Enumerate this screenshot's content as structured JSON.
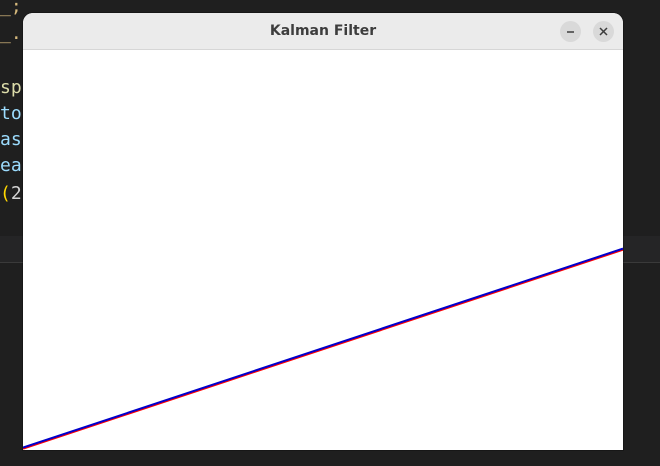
{
  "background_editor": {
    "code_fragments": [
      {
        "text": "_;",
        "color": "#d7ba7d"
      },
      {
        "text": "_.",
        "color": "#d7ba7d"
      },
      {
        "text": "sp",
        "color": "#dcdcaa"
      },
      {
        "text": "to",
        "color": "#9cdcfe"
      },
      {
        "text": "as",
        "color": "#9cdcfe"
      },
      {
        "text": "ea",
        "color": "#9cdcfe"
      },
      {
        "text": "(2",
        "color": "#d4d4d4",
        "paren_color": "#ffd700"
      }
    ]
  },
  "window": {
    "title": "Kalman Filter",
    "minimize_icon": "minimize-icon",
    "close_icon": "close-icon"
  },
  "plot": {
    "series": [
      {
        "color": "#ff0000",
        "start": [
          0,
          0
        ],
        "end": [
          1,
          0.5
        ]
      },
      {
        "color": "#0000cc",
        "start": [
          0,
          0
        ],
        "end": [
          1,
          0.5
        ]
      }
    ]
  }
}
